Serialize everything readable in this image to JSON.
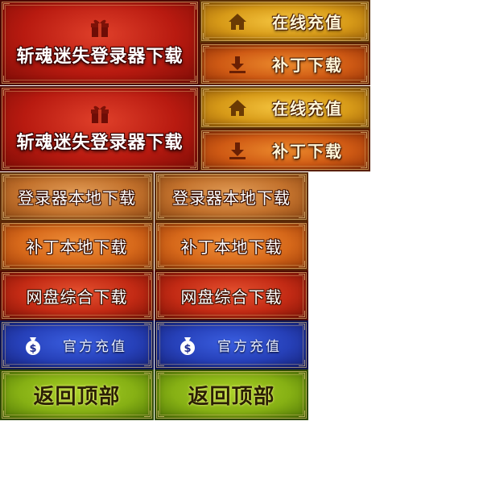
{
  "top_section": {
    "login_download_label": "斩魂迷失登录器下载",
    "online_recharge_label": "在线充值",
    "patch_download_label": "补丁下载"
  },
  "grid": {
    "launcher_local_download": "登录器本地下载",
    "patch_local_download": "补丁本地下载",
    "netdisk_download": "网盘综合下载",
    "official_recharge": "官方充值",
    "back_to_top": "返回顶部"
  },
  "icons": {
    "gift": "gift-icon",
    "home": "home-icon",
    "download": "download-icon",
    "money_bag": "money-bag-icon"
  },
  "colors": {
    "red_button": "#c21c10",
    "gold_button": "#d79a18",
    "orange_button": "#cf5a14",
    "tan_button": "#c2712c",
    "blue_button": "#2640b8",
    "green_button": "#86b014"
  }
}
